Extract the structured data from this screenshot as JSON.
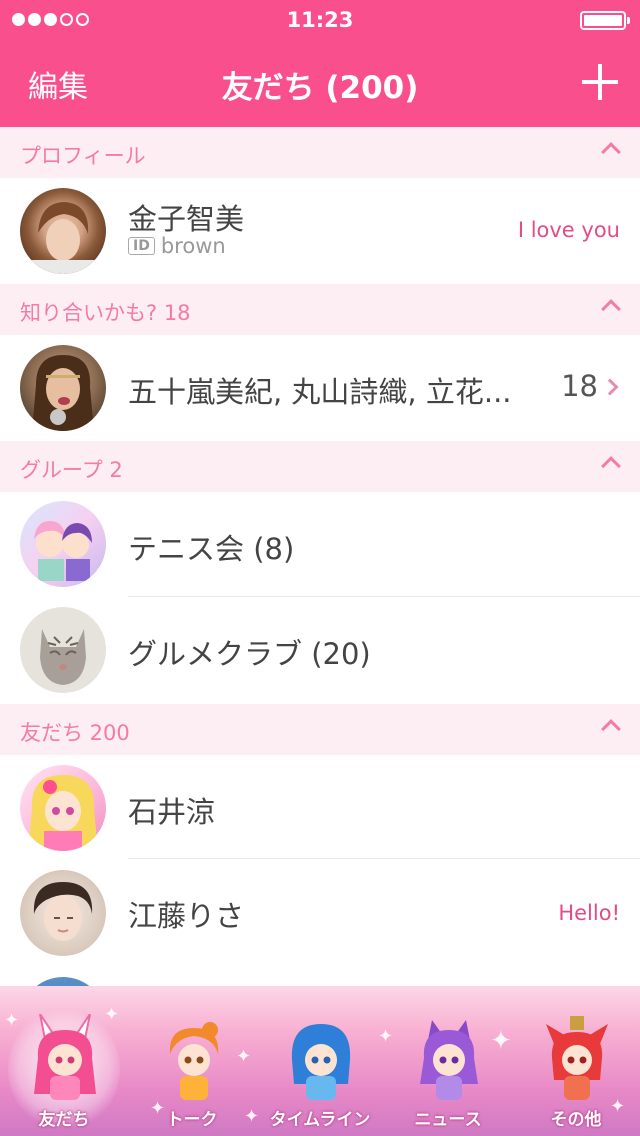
{
  "status_bar": {
    "time": "11:23",
    "signal_bars_filled": 3,
    "signal_bars_total": 5
  },
  "nav": {
    "edit_label": "編集",
    "title": "友だち (200)"
  },
  "sections": {
    "profile": {
      "label": "プロフィール"
    },
    "suggested": {
      "label": "知り合いかも? 18"
    },
    "groups": {
      "label": "グループ 2"
    },
    "friends": {
      "label": "友だち 200"
    }
  },
  "profile": {
    "name": "金子智美",
    "id_badge": "ID",
    "id_value": "brown",
    "status_message": "I love you"
  },
  "suggested": {
    "names": "五十嵐美紀, 丸山詩織, 立花...",
    "count": "18"
  },
  "groups": [
    {
      "name": "テニス会 (8)"
    },
    {
      "name": "グルメクラブ (20)"
    }
  ],
  "friends": [
    {
      "name": "石井涼",
      "status_message": ""
    },
    {
      "name": "江藤りさ",
      "status_message": "Hello!"
    }
  ],
  "tabbar": {
    "tabs": [
      {
        "label": "友だち",
        "active": true
      },
      {
        "label": "トーク",
        "active": false
      },
      {
        "label": "タイムライン",
        "active": false
      },
      {
        "label": "ニュース",
        "active": false
      },
      {
        "label": "その他",
        "active": false
      }
    ]
  },
  "colors": {
    "accent": "#f9508d",
    "section_bg": "#fdeef3",
    "section_text": "#f47ba3",
    "status_text": "#e44c86"
  }
}
